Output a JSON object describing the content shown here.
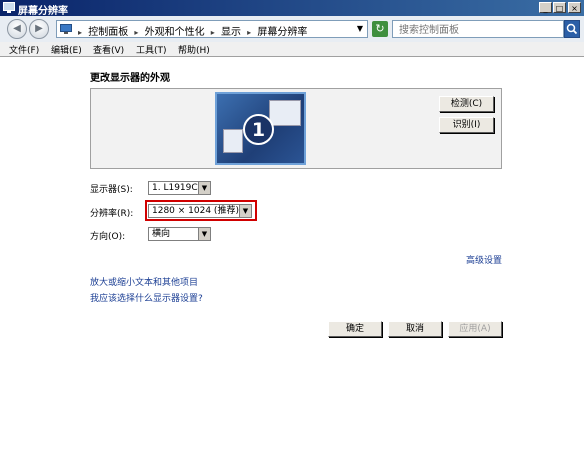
{
  "window": {
    "title": "屏幕分辨率",
    "minimize_glyph": "_",
    "maximize_glyph": "□",
    "close_glyph": "×"
  },
  "address_bar": {
    "breadcrumbs": [
      "控制面板",
      "外观和个性化",
      "显示",
      "屏幕分辨率"
    ],
    "separator": "▸",
    "dropdown_glyph": "▼",
    "back_glyph": "◀",
    "forward_glyph": "▶",
    "refresh_glyph": "↻",
    "search_placeholder": "搜索控制面板"
  },
  "menu": {
    "items": [
      "文件(F)",
      "编辑(E)",
      "查看(V)",
      "工具(T)",
      "帮助(H)"
    ]
  },
  "main": {
    "heading": "更改显示器的外观",
    "monitor_number": "1",
    "detect_label": "检测(C)",
    "identify_label": "识别(I)",
    "display": {
      "label": "显示器(S):",
      "value": "1. L1919C"
    },
    "resolution": {
      "label": "分辨率(R):",
      "value": "1280 × 1024 (推荐)"
    },
    "orientation": {
      "label": "方向(O):",
      "value": "横向"
    },
    "advanced_link": "高级设置",
    "links": [
      "放大或缩小文本和其他项目",
      "我应该选择什么显示器设置?"
    ],
    "buttons": {
      "ok": "确定",
      "cancel": "取消",
      "apply": "应用(A)"
    }
  },
  "icons": [
    "monitor-app-icon",
    "back-arrow-icon",
    "forward-arrow-icon",
    "computer-icon",
    "refresh-icon",
    "search-icon",
    "chevron-down-icon"
  ],
  "colors": {
    "titlebar_start": "#0a246a",
    "titlebar_end": "#3a6ea5",
    "link": "#1c3f94",
    "highlight_border": "#d00000"
  }
}
